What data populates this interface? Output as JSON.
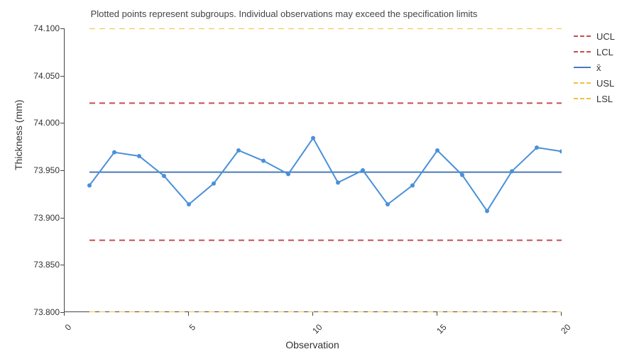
{
  "chart_data": {
    "type": "line",
    "title": "",
    "subtitle": "Plotted points represent subgroups. Individual observations may exceed the specification limits",
    "xlabel": "Observation",
    "ylabel": "Thickness (mm)",
    "xlim": [
      0,
      20
    ],
    "ylim": [
      73.8,
      74.1
    ],
    "yticks": [
      73.8,
      73.85,
      73.9,
      73.95,
      74.0,
      74.05,
      74.1
    ],
    "ytick_labels": [
      "73.800",
      "73.850",
      "73.900",
      "73.950",
      "74.000",
      "74.050",
      "74.100"
    ],
    "xticks": [
      0,
      5,
      10,
      15,
      20
    ],
    "xtick_labels": [
      "0",
      "5",
      "10",
      "15",
      "20"
    ],
    "x": [
      1,
      2,
      3,
      4,
      5,
      6,
      7,
      8,
      9,
      10,
      11,
      12,
      13,
      14,
      15,
      16,
      17,
      18,
      19,
      20
    ],
    "values": [
      73.934,
      73.969,
      73.965,
      73.944,
      73.914,
      73.936,
      73.971,
      73.96,
      73.946,
      73.984,
      73.937,
      73.95,
      73.914,
      73.934,
      73.971,
      73.945,
      73.907,
      73.949,
      73.974,
      73.97
    ],
    "reference_lines": {
      "UCL": 74.021,
      "LCL": 73.876,
      "x_bar": 73.948,
      "USL": 74.1,
      "LSL": 73.8
    },
    "ref_x_range": [
      1,
      20
    ],
    "colors": {
      "series": "#4a90d9",
      "ucl_lcl": "#c44e52",
      "xbar": "#4a7bb5",
      "usl_lsl": "#f0c040"
    },
    "legend": [
      {
        "label": "UCL",
        "color": "#c44e52",
        "style": "dashed"
      },
      {
        "label": "LCL",
        "color": "#c44e52",
        "style": "dashed"
      },
      {
        "label": "x̄",
        "color": "#4a7bb5",
        "style": "solid"
      },
      {
        "label": "USL",
        "color": "#f0c040",
        "style": "dashed"
      },
      {
        "label": "LSL",
        "color": "#f0c040",
        "style": "dashed"
      }
    ]
  }
}
